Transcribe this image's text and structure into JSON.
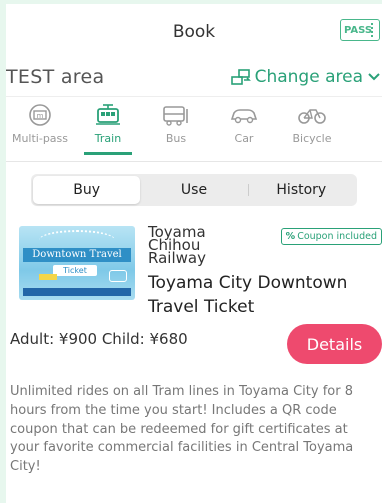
{
  "header": {
    "title": "Book",
    "pass_badge": "PASS"
  },
  "area": {
    "title": "TEST area",
    "change_label": "Change area"
  },
  "modes": [
    {
      "label": "Multi-pass",
      "icon": "multipass-icon",
      "active": false
    },
    {
      "label": "Train",
      "icon": "train-icon",
      "active": true
    },
    {
      "label": "Bus",
      "icon": "bus-icon",
      "active": false
    },
    {
      "label": "Car",
      "icon": "car-icon",
      "active": false
    },
    {
      "label": "Bicycle",
      "icon": "bicycle-icon",
      "active": false
    }
  ],
  "segment": {
    "buy": "Buy",
    "use": "Use",
    "history": "History",
    "selected": "Buy"
  },
  "ticket": {
    "operator": "Toyama Chihou Railway",
    "coupon_badge": "Coupon included",
    "name": "Toyama City Downtown Travel Ticket",
    "price": "Adult: ¥900 Child: ¥680",
    "details_label": "Details",
    "description": "Unlimited rides on all Tram lines in Toyama City for 8 hours from the time you start! Includes a QR code coupon that can be redeemed for gift certificates at your favorite commercial facilities in Central Toyama City!",
    "image_banner": "Downtown Travel",
    "image_sub": "Ticket"
  },
  "colors": {
    "accent": "#2aa178",
    "details": "#ee4a6e",
    "background": "#e7f7ee"
  }
}
